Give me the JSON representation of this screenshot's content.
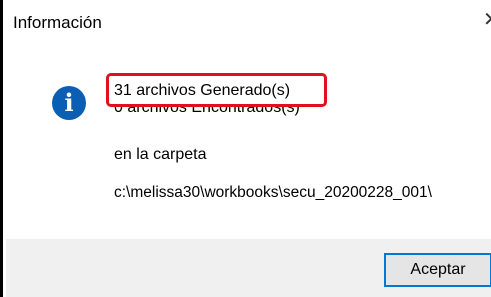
{
  "dialog": {
    "title": "Información",
    "close_icon": "close-icon",
    "info_icon": "info-icon",
    "info_glyph": "i",
    "messages": {
      "generated": "31 archivos Generado(s)",
      "found": "0 archivos Encontrados(s)",
      "folder_label": "en la carpeta",
      "folder_path": "c:\\melissa30\\workbooks\\secu_20200228_001\\"
    },
    "accept_label": "Aceptar",
    "colors": {
      "accent": "#0078d7",
      "info_icon": "#0a5fb4",
      "highlight": "#e0111f",
      "footer": "#f0f0f0"
    }
  }
}
